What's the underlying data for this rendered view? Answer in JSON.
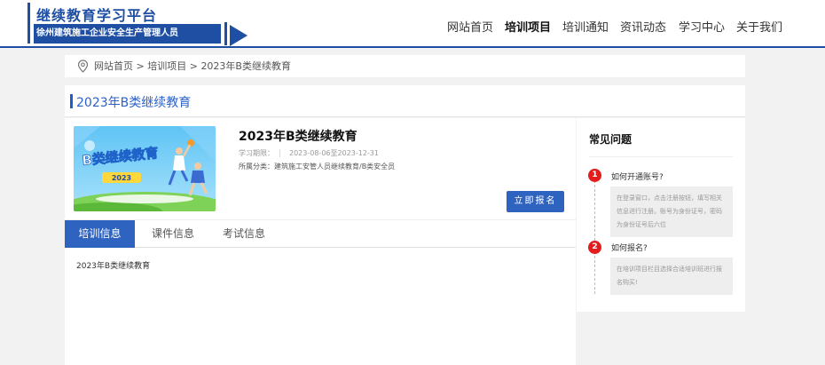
{
  "site": {
    "title": "继续教育学习平台",
    "subtitle": "徐州建筑施工企业安全生产管理人员",
    "brand_color": "#1f4fa3"
  },
  "nav": {
    "items": [
      {
        "label": "网站首页",
        "active": false
      },
      {
        "label": "培训项目",
        "active": true
      },
      {
        "label": "培训通知",
        "active": false
      },
      {
        "label": "资讯动态",
        "active": false
      },
      {
        "label": "学习中心",
        "active": false
      },
      {
        "label": "关于我们",
        "active": false
      }
    ]
  },
  "breadcrumb": {
    "icon": "location-pin-icon",
    "items": [
      "网站首页",
      "培训项目",
      "2023年B类继续教育"
    ],
    "separator": ">"
  },
  "page": {
    "title": "2023年B类继续教育",
    "accent_color": "#2e63c0"
  },
  "course": {
    "image_text": "B类继续教育",
    "image_year": "2023",
    "title": "2023年B类继续教育",
    "period_label": "学习期限：",
    "period_value": "2023-08-06至2023-12-31",
    "category": "所属分类：建筑施工安管人员继续教育/B类安全员",
    "signup_label": "立即报名"
  },
  "tabs": {
    "items": [
      {
        "label": "培训信息",
        "active": true
      },
      {
        "label": "课件信息",
        "active": false
      },
      {
        "label": "考试信息",
        "active": false
      }
    ],
    "content": "2023年B类继续教育"
  },
  "faq": {
    "title": "常见问题",
    "badge_color": "#e31c1c",
    "items": [
      {
        "num": "1",
        "question": "如何开通账号?",
        "answer": "在登录窗口，点击注册按钮，填写相关信息进行注册。账号为身份证号，密码为身份证号后六位"
      },
      {
        "num": "2",
        "question": "如何报名?",
        "answer": "在培训项目栏目选择合适培训班进行报名购买!"
      }
    ]
  }
}
